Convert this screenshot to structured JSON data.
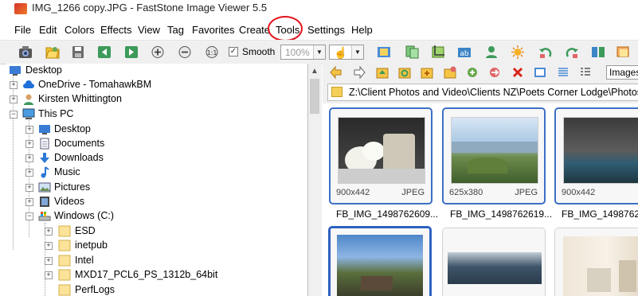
{
  "window": {
    "title": "IMG_1266 copy.JPG  -  FastStone Image Viewer 5.5"
  },
  "menu": [
    "File",
    "Edit",
    "Colors",
    "Effects",
    "View",
    "Tag",
    "Favorites",
    "Create",
    "Tools",
    "Settings",
    "Help"
  ],
  "toolbar": {
    "smooth_label": "Smooth",
    "smooth_checked": "✓",
    "zoom_value": "100%",
    "combo_arrow": "▼",
    "accent": "#e3121c",
    "icons": [
      "camera-icon",
      "open-folder-icon",
      "save-icon",
      "previous-icon",
      "next-icon",
      "zoom-in-icon",
      "zoom-out-icon",
      "actual-size-icon",
      "hand-tool-icon",
      "film-strip-icon",
      "copy-to-icon",
      "crop-icon",
      "rename-icon",
      "user-icon",
      "brightness-icon",
      "rotate-left-icon",
      "rotate-right-icon",
      "compare-icon",
      "fullscreen-icon"
    ]
  },
  "tree": {
    "items": [
      {
        "label": "Desktop",
        "icon": "desktop-icon",
        "exp": ""
      },
      {
        "label": "OneDrive - TomahawkBM",
        "icon": "cloud-icon",
        "exp": "+"
      },
      {
        "label": "Kirsten Whittington",
        "icon": "user-folder-icon",
        "exp": "+"
      },
      {
        "label": "This PC",
        "icon": "computer-icon",
        "exp": "−"
      },
      {
        "label": "Desktop",
        "icon": "desktop-icon",
        "exp": "+"
      },
      {
        "label": "Documents",
        "icon": "documents-icon",
        "exp": "+"
      },
      {
        "label": "Downloads",
        "icon": "download-icon",
        "exp": "+"
      },
      {
        "label": "Music",
        "icon": "music-icon",
        "exp": "+"
      },
      {
        "label": "Pictures",
        "icon": "pictures-icon",
        "exp": "+"
      },
      {
        "label": "Videos",
        "icon": "video-icon",
        "exp": "+"
      },
      {
        "label": "Windows (C:)",
        "icon": "drive-icon",
        "exp": "−"
      },
      {
        "label": "ESD",
        "icon": "folder-icon",
        "exp": "+"
      },
      {
        "label": "inetpub",
        "icon": "folder-icon",
        "exp": "+"
      },
      {
        "label": "Intel",
        "icon": "folder-icon",
        "exp": "+"
      },
      {
        "label": "MXD17_PCL6_PS_1312b_64bit",
        "icon": "folder-icon",
        "exp": "+"
      },
      {
        "label": "PerfLogs",
        "icon": "folder-icon",
        "exp": ""
      }
    ]
  },
  "browser": {
    "view_mode": "Images",
    "path": "Z:\\Client Photos and Video\\Clients NZ\\Poets Corner Lodge\\Photos",
    "nav_icons": [
      "back-icon",
      "forward-icon",
      "parent-folder-icon",
      "refresh-icon",
      "new-folder-icon",
      "favorite-folder-icon",
      "copy-icon",
      "move-icon",
      "delete-icon",
      "thumbnail-view-icon",
      "details-view-icon",
      "list-view-icon"
    ],
    "thumbnails": [
      {
        "dims": "900x442",
        "format": "JPEG",
        "name": "FB_IMG_1498762609...",
        "selected": true
      },
      {
        "dims": "625x380",
        "format": "JPEG",
        "name": "FB_IMG_1498762619...",
        "selected": true
      },
      {
        "dims": "900x442",
        "format": "",
        "name": "FB_IMG_1498762",
        "selected": true
      },
      {
        "dims": "",
        "format": "",
        "name": "",
        "selected": true
      },
      {
        "dims": "",
        "format": "",
        "name": "",
        "selected": false
      },
      {
        "dims": "",
        "format": "",
        "name": "",
        "selected": false
      }
    ]
  }
}
